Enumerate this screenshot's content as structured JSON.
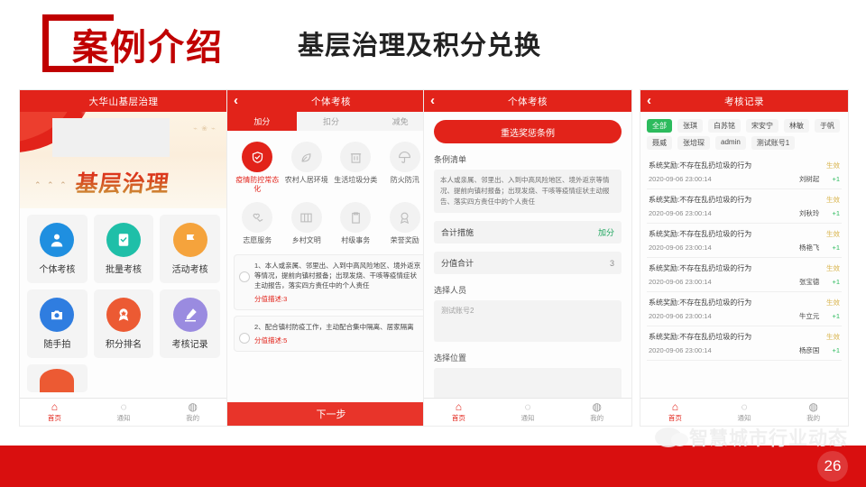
{
  "header": {
    "badge_title": "案例介绍",
    "subtitle": "基层治理及积分兑换"
  },
  "phone1": {
    "title": "大华山基层治理",
    "banner_text": "基层治理",
    "menu": [
      {
        "label": "个体考核",
        "icon": "person-icon",
        "color": "#1f8fe0"
      },
      {
        "label": "批量考核",
        "icon": "clipboard-check-icon",
        "color": "#1fbfa8"
      },
      {
        "label": "活动考核",
        "icon": "flag-icon",
        "color": "#f5a33c"
      },
      {
        "label": "随手拍",
        "icon": "camera-icon",
        "color": "#2f7de0"
      },
      {
        "label": "积分排名",
        "icon": "medal-star-icon",
        "color": "#ec5a33"
      },
      {
        "label": "考核记录",
        "icon": "pencil-icon",
        "color": "#9a8be0"
      }
    ],
    "tabbar": [
      {
        "label": "首页",
        "icon": "home-icon",
        "active": true
      },
      {
        "label": "通知",
        "icon": "bell-icon",
        "active": false
      },
      {
        "label": "我的",
        "icon": "user-icon",
        "active": false
      }
    ]
  },
  "phone2": {
    "title": "个体考核",
    "back_icon": "chevron-left-icon",
    "tabs": [
      {
        "label": "加分",
        "active": true
      },
      {
        "label": "扣分",
        "active": false
      },
      {
        "label": "减免",
        "active": false
      }
    ],
    "categories": [
      {
        "label": "疫情防控常态化",
        "icon": "shield-check-icon",
        "active": true
      },
      {
        "label": "农村人居环境",
        "icon": "leaf-icon",
        "active": false
      },
      {
        "label": "生活垃圾分类",
        "icon": "trash-icon",
        "active": false
      },
      {
        "label": "防火防汛",
        "icon": "umbrella-icon",
        "active": false
      },
      {
        "label": "志愿服务",
        "icon": "handshake-heart-icon",
        "active": false
      },
      {
        "label": "乡村文明",
        "icon": "book-icon",
        "active": false
      },
      {
        "label": "村级事务",
        "icon": "document-icon",
        "active": false
      },
      {
        "label": "荣誉奖励",
        "icon": "award-icon",
        "active": false
      }
    ],
    "rules": [
      {
        "text": "1、本人或亲属、邻里出、入到中高风险地区、境外返京等情况，提前向镇村报备；出现发烧、干咳等疫情症状主动报告，落实四方责任中的个人责任",
        "score_label": "分值描述:3"
      },
      {
        "text": "2、配合镇村防疫工作，主动配合集中隔离、居家隔离",
        "score_label": "分值描述:5"
      }
    ],
    "next_button": "下一步"
  },
  "phone3": {
    "title": "个体考核",
    "back_icon": "chevron-left-icon",
    "reselect_button": "重选奖惩条例",
    "list_label": "条例清单",
    "rule_text": "本人或亲属、邻里出、入到中高风险地区、境外返京等情况、提前向镇村报备；出现发烧、干咳等疫情症状主动报告、落实四方责任中的个人责任",
    "measure_label": "合计措施",
    "measure_value": "加分",
    "score_label": "分值合计",
    "score_value": "3",
    "person_label": "选择人员",
    "person_value": "测试账号2",
    "location_label": "选择位置",
    "location_value": "",
    "tabbar": [
      {
        "label": "首页",
        "icon": "home-icon",
        "active": true
      },
      {
        "label": "通知",
        "icon": "bell-icon",
        "active": false
      },
      {
        "label": "我的",
        "icon": "user-icon",
        "active": false
      }
    ]
  },
  "phone4": {
    "title": "考核记录",
    "back_icon": "chevron-left-icon",
    "chips": [
      {
        "label": "全部",
        "active": true
      },
      {
        "label": "张琪",
        "active": false
      },
      {
        "label": "白苏铭",
        "active": false
      },
      {
        "label": "宋安宁",
        "active": false
      },
      {
        "label": "林敏",
        "active": false
      },
      {
        "label": "于帆",
        "active": false
      },
      {
        "label": "聂威",
        "active": false
      },
      {
        "label": "张培琛",
        "active": false
      },
      {
        "label": "admin",
        "active": false
      },
      {
        "label": "测试账号1",
        "active": false
      }
    ],
    "records": [
      {
        "title": "系统奖励:不存在乱扔垃圾的行为",
        "status": "生效",
        "datetime": "2020-09-06 23:00:14",
        "name": "刘树起",
        "points": "+1"
      },
      {
        "title": "系统奖励:不存在乱扔垃圾的行为",
        "status": "生效",
        "datetime": "2020-09-06 23:00:14",
        "name": "刘秋玲",
        "points": "+1"
      },
      {
        "title": "系统奖励:不存在乱扔垃圾的行为",
        "status": "生效",
        "datetime": "2020-09-06 23:00:14",
        "name": "杨艳飞",
        "points": "+1"
      },
      {
        "title": "系统奖励:不存在乱扔垃圾的行为",
        "status": "生效",
        "datetime": "2020-09-06 23:00:14",
        "name": "张宝德",
        "points": "+1"
      },
      {
        "title": "系统奖励:不存在乱扔垃圾的行为",
        "status": "生效",
        "datetime": "2020-09-06 23:00:14",
        "name": "牛立元",
        "points": "+1"
      },
      {
        "title": "系统奖励:不存在乱扔垃圾的行为",
        "status": "生效",
        "datetime": "2020-09-06 23:00:14",
        "name": "杨彦国",
        "points": "+1"
      }
    ],
    "tabbar": [
      {
        "label": "首页",
        "icon": "home-icon",
        "active": true
      },
      {
        "label": "通知",
        "icon": "bell-icon",
        "active": false
      },
      {
        "label": "我的",
        "icon": "user-icon",
        "active": false
      }
    ]
  },
  "footer": {
    "watermark": "智慧城市行业动态",
    "watermark_icon": "wechat-icon",
    "page_number": "26",
    "bar_color": "#d90f0f"
  }
}
